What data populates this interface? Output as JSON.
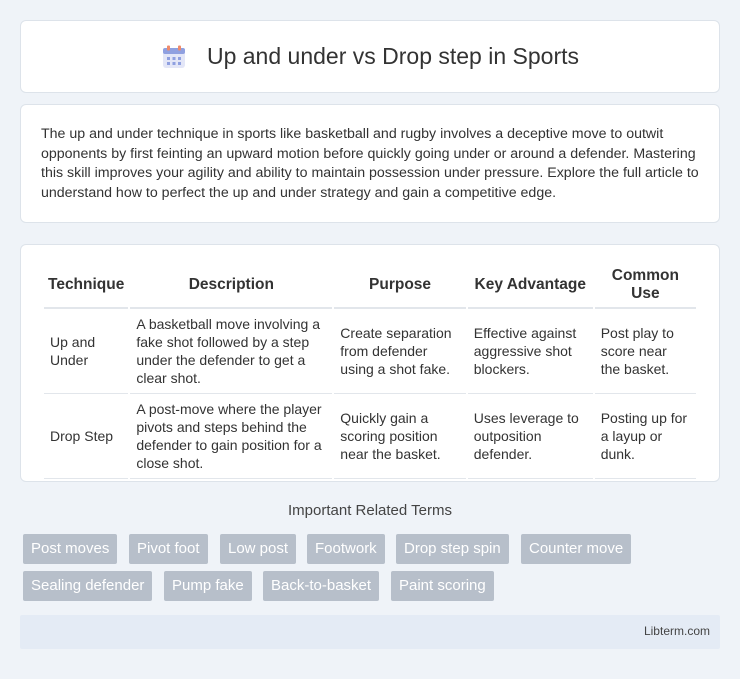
{
  "header": {
    "title": "Up and under vs Drop step in Sports",
    "icon": "calendar-icon"
  },
  "intro": {
    "text": "The up and under technique in sports like basketball and rugby involves a deceptive move to outwit opponents by first feinting an upward motion before quickly going under or around a defender. Mastering this skill improves your agility and ability to maintain possession under pressure. Explore the full article to understand how to perfect the up and under strategy and gain a competitive edge."
  },
  "table": {
    "headers": [
      "Technique",
      "Description",
      "Purpose",
      "Key Advantage",
      "Common Use"
    ],
    "rows": [
      [
        "Up and Under",
        "A basketball move involving a fake shot followed by a step under the defender to get a clear shot.",
        "Create separation from defender using a shot fake.",
        "Effective against aggressive shot blockers.",
        "Post play to score near the basket."
      ],
      [
        "Drop Step",
        "A post-move where the player pivots and steps behind the defender to gain position for a close shot.",
        "Quickly gain a scoring position near the basket.",
        "Uses leverage to outposition defender.",
        "Posting up for a layup or dunk."
      ]
    ]
  },
  "related": {
    "title": "Important Related Terms",
    "tags": [
      "Post moves",
      "Pivot foot",
      "Low post",
      "Footwork",
      "Drop step spin",
      "Counter move",
      "Sealing defender",
      "Pump fake",
      "Back-to-basket",
      "Paint scoring"
    ]
  },
  "footer": {
    "text": "Libterm.com"
  }
}
